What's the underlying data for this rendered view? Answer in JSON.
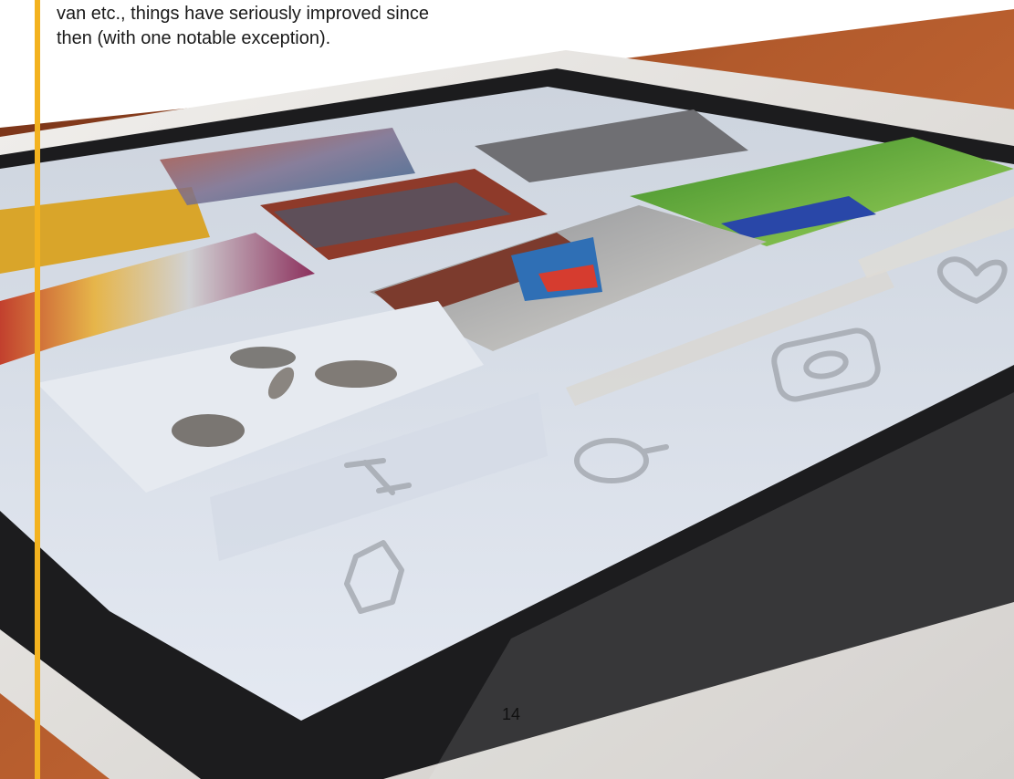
{
  "caption": {
    "line1": "van etc., things have seriously improved since",
    "line2": "then (with one notable exception)."
  },
  "page_number": "14",
  "photo": {
    "subject": "tablet-photo-gallery-app",
    "icons": [
      "heart-icon",
      "camera-icon",
      "search-icon",
      "home-icon"
    ]
  },
  "colors": {
    "accent_rule": "#f3b21f",
    "table_wood": "#a5522a",
    "tablet_bezel": "#1c1c1e",
    "tablet_frame": "#e8e6e3",
    "screen": "#dde4ee"
  }
}
